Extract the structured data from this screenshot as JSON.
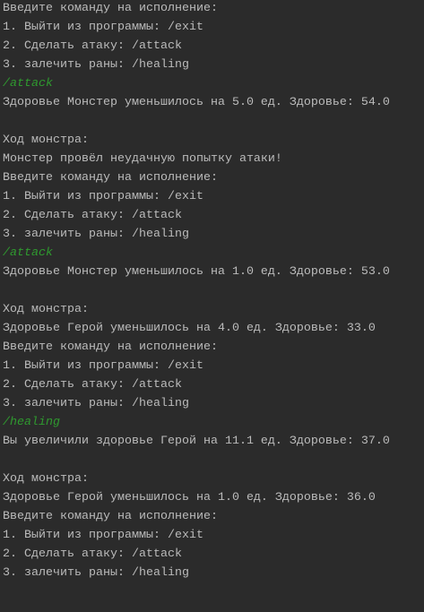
{
  "colors": {
    "background": "#2b2b2b",
    "output": "#bbbbbb",
    "user_input": "#2f9a2f"
  },
  "console": {
    "lines": [
      {
        "text": "Введите команду на исполнение:",
        "type": "output"
      },
      {
        "text": "1. Выйти из программы: /exit",
        "type": "output"
      },
      {
        "text": "2. Сделать атаку: /attack",
        "type": "output"
      },
      {
        "text": "3. залечить раны: /healing",
        "type": "output"
      },
      {
        "text": "/attack",
        "type": "input"
      },
      {
        "text": "Здоровье Монстер уменьшилось на 5.0 ед. Здоровье: 54.0",
        "type": "output"
      },
      {
        "text": "",
        "type": "output"
      },
      {
        "text": "Ход монстра:",
        "type": "output"
      },
      {
        "text": "Монстер провёл неудачную попытку атаки!",
        "type": "output"
      },
      {
        "text": "Введите команду на исполнение:",
        "type": "output"
      },
      {
        "text": "1. Выйти из программы: /exit",
        "type": "output"
      },
      {
        "text": "2. Сделать атаку: /attack",
        "type": "output"
      },
      {
        "text": "3. залечить раны: /healing",
        "type": "output"
      },
      {
        "text": "/attack",
        "type": "input"
      },
      {
        "text": "Здоровье Монстер уменьшилось на 1.0 ед. Здоровье: 53.0",
        "type": "output"
      },
      {
        "text": "",
        "type": "output"
      },
      {
        "text": "Ход монстра:",
        "type": "output"
      },
      {
        "text": "Здоровье Герой уменьшилось на 4.0 ед. Здоровье: 33.0",
        "type": "output"
      },
      {
        "text": "Введите команду на исполнение:",
        "type": "output"
      },
      {
        "text": "1. Выйти из программы: /exit",
        "type": "output"
      },
      {
        "text": "2. Сделать атаку: /attack",
        "type": "output"
      },
      {
        "text": "3. залечить раны: /healing",
        "type": "output"
      },
      {
        "text": "/healing",
        "type": "input"
      },
      {
        "text": "Вы увеличили здоровье Герой на 11.1 ед. Здоровье: 37.0",
        "type": "output"
      },
      {
        "text": "",
        "type": "output"
      },
      {
        "text": "Ход монстра:",
        "type": "output"
      },
      {
        "text": "Здоровье Герой уменьшилось на 1.0 ед. Здоровье: 36.0",
        "type": "output"
      },
      {
        "text": "Введите команду на исполнение:",
        "type": "output"
      },
      {
        "text": "1. Выйти из программы: /exit",
        "type": "output"
      },
      {
        "text": "2. Сделать атаку: /attack",
        "type": "output"
      },
      {
        "text": "3. залечить раны: /healing",
        "type": "output"
      }
    ]
  }
}
